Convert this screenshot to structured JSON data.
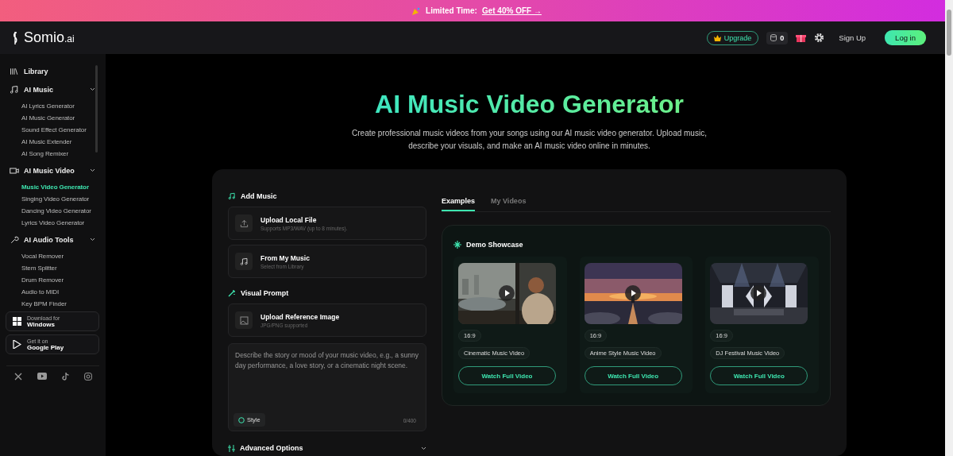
{
  "banner": {
    "label": "Limited Time:",
    "link": "Get 40% OFF →"
  },
  "header": {
    "logo": "Somio",
    "logo_suffix": ".ai",
    "upgrade": "Upgrade",
    "credits": "0",
    "sign_up": "Sign Up",
    "log_in": "Log in"
  },
  "sidebar": {
    "items": [
      {
        "label": "Library"
      },
      {
        "label": "AI Music",
        "expanded": true,
        "children": [
          {
            "label": "AI Lyrics Generator",
            "selected": false
          },
          {
            "label": "AI Music Generator",
            "selected": false
          },
          {
            "label": "Sound Effect Generator",
            "selected": false
          },
          {
            "label": "AI Music Extender",
            "selected": false
          },
          {
            "label": "AI Song Remixer",
            "selected": false
          }
        ]
      },
      {
        "label": "AI Music Video",
        "expanded": true,
        "children": [
          {
            "label": "Music Video Generator",
            "selected": true
          },
          {
            "label": "Singing Video Generator",
            "selected": false
          },
          {
            "label": "Dancing Video Generator",
            "selected": false
          },
          {
            "label": "Lyrics Video Generator",
            "selected": false
          }
        ]
      },
      {
        "label": "AI Audio Tools",
        "expanded": true,
        "children": [
          {
            "label": "Vocal Remover",
            "selected": false
          },
          {
            "label": "Stem Splitter",
            "selected": false
          },
          {
            "label": "Drum Remover",
            "selected": false
          },
          {
            "label": "Audio to MIDI",
            "selected": false
          },
          {
            "label": "Key BPM Finder",
            "selected": false
          }
        ]
      }
    ],
    "downloads": [
      {
        "small": "Download for",
        "big": "Windows"
      },
      {
        "small": "Get it on",
        "big": "Google Play"
      }
    ]
  },
  "hero": {
    "title": "AI Music Video Generator",
    "subtitle": "Create professional music videos from your songs using our AI music video generator. Upload music, describe your visuals, and make an AI music video online in minutes."
  },
  "form": {
    "add_music": {
      "title": "Add Music",
      "options": [
        {
          "title": "Upload Local File",
          "hint": "Supports MP3/WAV (up to 8 minutes)."
        },
        {
          "title": "From My Music",
          "hint": "Select from Library"
        }
      ]
    },
    "visual_prompt": {
      "title": "Visual Prompt",
      "upload": {
        "title": "Upload Reference Image",
        "hint": "JPG/PNG supported"
      },
      "placeholder": "Describe the story or mood of your music video, e.g., a sunny day performance, a love story, or a cinematic night scene.",
      "style": "Style",
      "count": "0/400"
    },
    "advanced": "Advanced Options"
  },
  "tabs": [
    {
      "label": "Examples",
      "selected": true
    },
    {
      "label": "My Videos",
      "selected": false
    }
  ],
  "showcase": {
    "title": "Demo Showcase",
    "videos": [
      {
        "aspect": "16:9",
        "title": "Cinematic Music Video",
        "button": "Watch Full Video"
      },
      {
        "aspect": "16:9",
        "title": "Anime Style Music Video",
        "button": "Watch Full Video"
      },
      {
        "aspect": "16:9",
        "title": "DJ Festival Music Video",
        "button": "Watch Full Video"
      }
    ]
  }
}
